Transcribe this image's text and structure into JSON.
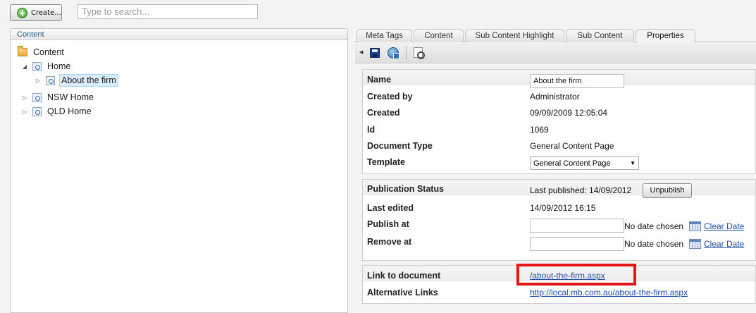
{
  "toolbar": {
    "create_label": "Create...",
    "search_placeholder": "Type to search..."
  },
  "tree": {
    "header": "Content",
    "items": [
      {
        "label": "Content"
      },
      {
        "label": "Home"
      },
      {
        "label": "About the firm"
      },
      {
        "label": "NSW Home"
      },
      {
        "label": "QLD Home"
      }
    ]
  },
  "tabs": [
    {
      "label": "Meta Tags"
    },
    {
      "label": "Content"
    },
    {
      "label": "Sub Content Highlight"
    },
    {
      "label": "Sub Content"
    },
    {
      "label": "Properties"
    }
  ],
  "properties": {
    "name_label": "Name",
    "name_value": "About the firm",
    "created_by_label": "Created by",
    "created_by_value": "Administrator",
    "created_label": "Created",
    "created_value": "09/09/2009 12:05:04",
    "id_label": "Id",
    "id_value": "1069",
    "doctype_label": "Document Type",
    "doctype_value": "General Content Page",
    "template_label": "Template",
    "template_value": "General Content Page"
  },
  "publication": {
    "status_label": "Publication Status",
    "status_value": "Last published: 14/09/2012",
    "unpublish_label": "Unpublish",
    "last_edited_label": "Last edited",
    "last_edited_value": "14/09/2012 16:15",
    "publish_at_label": "Publish at",
    "publish_at_no_date": "No date chosen",
    "publish_at_clear": "Clear Date",
    "remove_at_label": "Remove at",
    "remove_at_no_date": "No date chosen",
    "remove_at_clear": "Clear Date"
  },
  "links": {
    "link_label": "Link to document",
    "link_value": "/about-the-firm.aspx",
    "alt_label": "Alternative Links",
    "alt_value": "http://local.mb.com.au/about-the-firm.aspx"
  },
  "colors": {
    "highlight_box": "#e51616",
    "link": "#1f4fa7",
    "tree_header": "#2b5e8c"
  }
}
